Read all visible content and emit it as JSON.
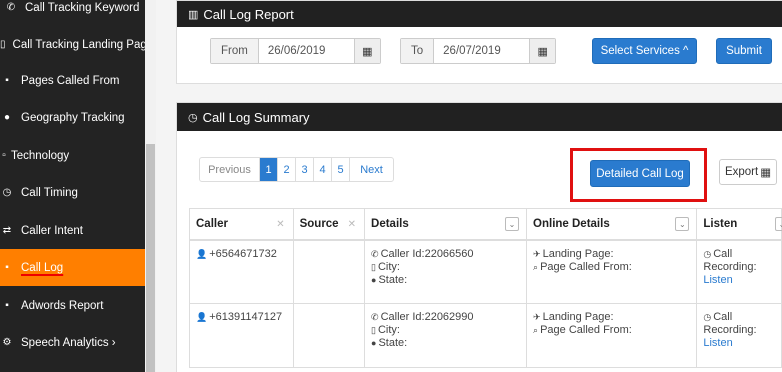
{
  "sidebar": {
    "items": [
      {
        "icon": "phone-icon",
        "glyph": "✆",
        "label": "Call Tracking Keyword"
      },
      {
        "icon": "file-icon",
        "glyph": "▯",
        "label": "Call Tracking Landing Page"
      },
      {
        "icon": "file-icon",
        "glyph": "▪",
        "label": "Pages Called From"
      },
      {
        "icon": "globe-icon",
        "glyph": "●",
        "label": "Geography Tracking"
      },
      {
        "icon": "laptop-icon",
        "glyph": "▫",
        "label": "Technology"
      },
      {
        "icon": "clock-icon",
        "glyph": "◷",
        "label": "Call Timing"
      },
      {
        "icon": "intent-icon",
        "glyph": "⇄",
        "label": "Caller Intent"
      },
      {
        "icon": "file-icon",
        "glyph": "▪",
        "label": "Call Log"
      },
      {
        "icon": "file-icon",
        "glyph": "▪",
        "label": "Adwords Report"
      },
      {
        "icon": "gear-icon",
        "glyph": "⚙",
        "label": "Speech Analytics ›"
      }
    ],
    "active_label": "Call Log"
  },
  "report": {
    "title": "Call Log Report",
    "title_icon": "bar-chart-icon",
    "from_label": "From",
    "from_value": "26/06/2019",
    "to_label": "To",
    "to_value": "26/07/2019",
    "calendar_glyph": "▦",
    "select_services": "Select Services ^",
    "submit": "Submit"
  },
  "summary": {
    "title": "Call Log Summary",
    "title_icon": "clock-icon",
    "pagination": {
      "previous": "Previous",
      "pages": [
        "1",
        "2",
        "3",
        "4",
        "5"
      ],
      "active_page": "1",
      "next": "Next"
    },
    "detailed_button": "Detailed Call Log",
    "export_label": "Export",
    "export_glyph": "▦"
  },
  "table": {
    "headers": {
      "caller": "Caller",
      "source": "Source",
      "details": "Details",
      "online": "Online Details",
      "listen": "Listen"
    },
    "rows": [
      {
        "caller": "+6564671732",
        "caller_id": "Caller Id:22066560",
        "city": "City:",
        "state": "State:",
        "landing": "Landing Page:",
        "page_called": "Page Called From:",
        "listen_1": "Call",
        "listen_2": "Recording:",
        "listen_link": "Listen"
      },
      {
        "caller": "+61391147127",
        "caller_id": "Caller Id:22062990",
        "city": "City:",
        "state": "State:",
        "landing": "Landing Page:",
        "page_called": "Page Called From:",
        "listen_1": "Call",
        "listen_2": "Recording:",
        "listen_link": "Listen"
      }
    ]
  },
  "colors": {
    "sidebar_bg": "#232323",
    "active": "#ff7f00",
    "primary": "#2a7bcf",
    "highlight": "#e01010"
  }
}
